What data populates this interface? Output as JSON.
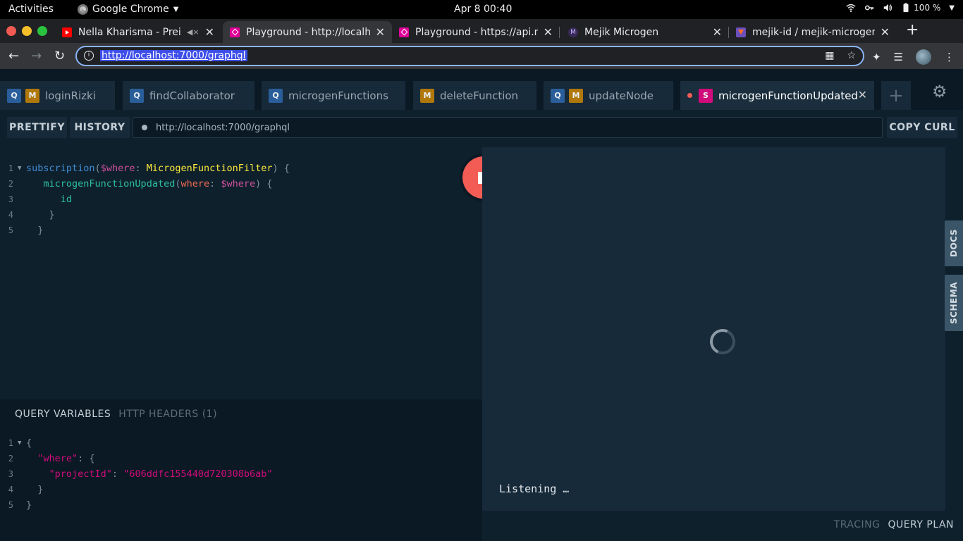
{
  "system": {
    "activities": "Activities",
    "app_name": "Google Chrome",
    "clock": "Apr 8  00:40",
    "battery": "100 %"
  },
  "chrome": {
    "tabs": [
      {
        "title": "Nella Kharisma - Prei K",
        "icon": "youtube-icon"
      },
      {
        "title": "Playground - http://localh",
        "icon": "graphql-icon"
      },
      {
        "title": "Playground - https://api.m",
        "icon": "graphql-icon"
      },
      {
        "title": "Mejik Microgen",
        "icon": "mejik-icon"
      },
      {
        "title": "mejik-id / mejik-microgen",
        "icon": "gitlab-icon"
      }
    ],
    "url": "http://localhost:7000/graphql"
  },
  "playground": {
    "tabs": [
      {
        "badges": [
          "Q",
          "M"
        ],
        "title": "loginRizki"
      },
      {
        "badges": [
          "Q"
        ],
        "title": "findCollaborator"
      },
      {
        "badges": [
          "Q"
        ],
        "title": "microgenFunctions"
      },
      {
        "badges": [
          "M"
        ],
        "title": "deleteFunction"
      },
      {
        "badges": [
          "Q",
          "M"
        ],
        "title": "updateNode"
      },
      {
        "badges": [
          "S"
        ],
        "title": "microgenFunctionUpdated"
      }
    ],
    "toolbar": {
      "prettify": "PRETTIFY",
      "history": "HISTORY",
      "endpoint": "http://localhost:7000/graphql",
      "copy_curl": "COPY CURL"
    },
    "query_lines": [
      "1",
      "2",
      "3",
      "4",
      "5"
    ],
    "query_tokens": {
      "subscription": "subscription",
      "var_where": "$where",
      "type_name": "MicrogenFunctionFilter",
      "field_name": "microgenFunctionUpdated",
      "arg_where": "where",
      "var_where2": "$where",
      "field_id": "id"
    },
    "variables": {
      "tab_active": "QUERY VARIABLES",
      "tab_inactive": "HTTP HEADERS (1)",
      "key_where": "\"where\"",
      "key_project": "\"projectId\"",
      "value_project": "\"606ddfc155440d720308b6ab\""
    },
    "result": {
      "status": "Listening …"
    },
    "side": {
      "docs": "DOCS",
      "schema": "SCHEMA"
    },
    "footer": {
      "tracing": "TRACING",
      "query_plan": "QUERY PLAN"
    }
  }
}
